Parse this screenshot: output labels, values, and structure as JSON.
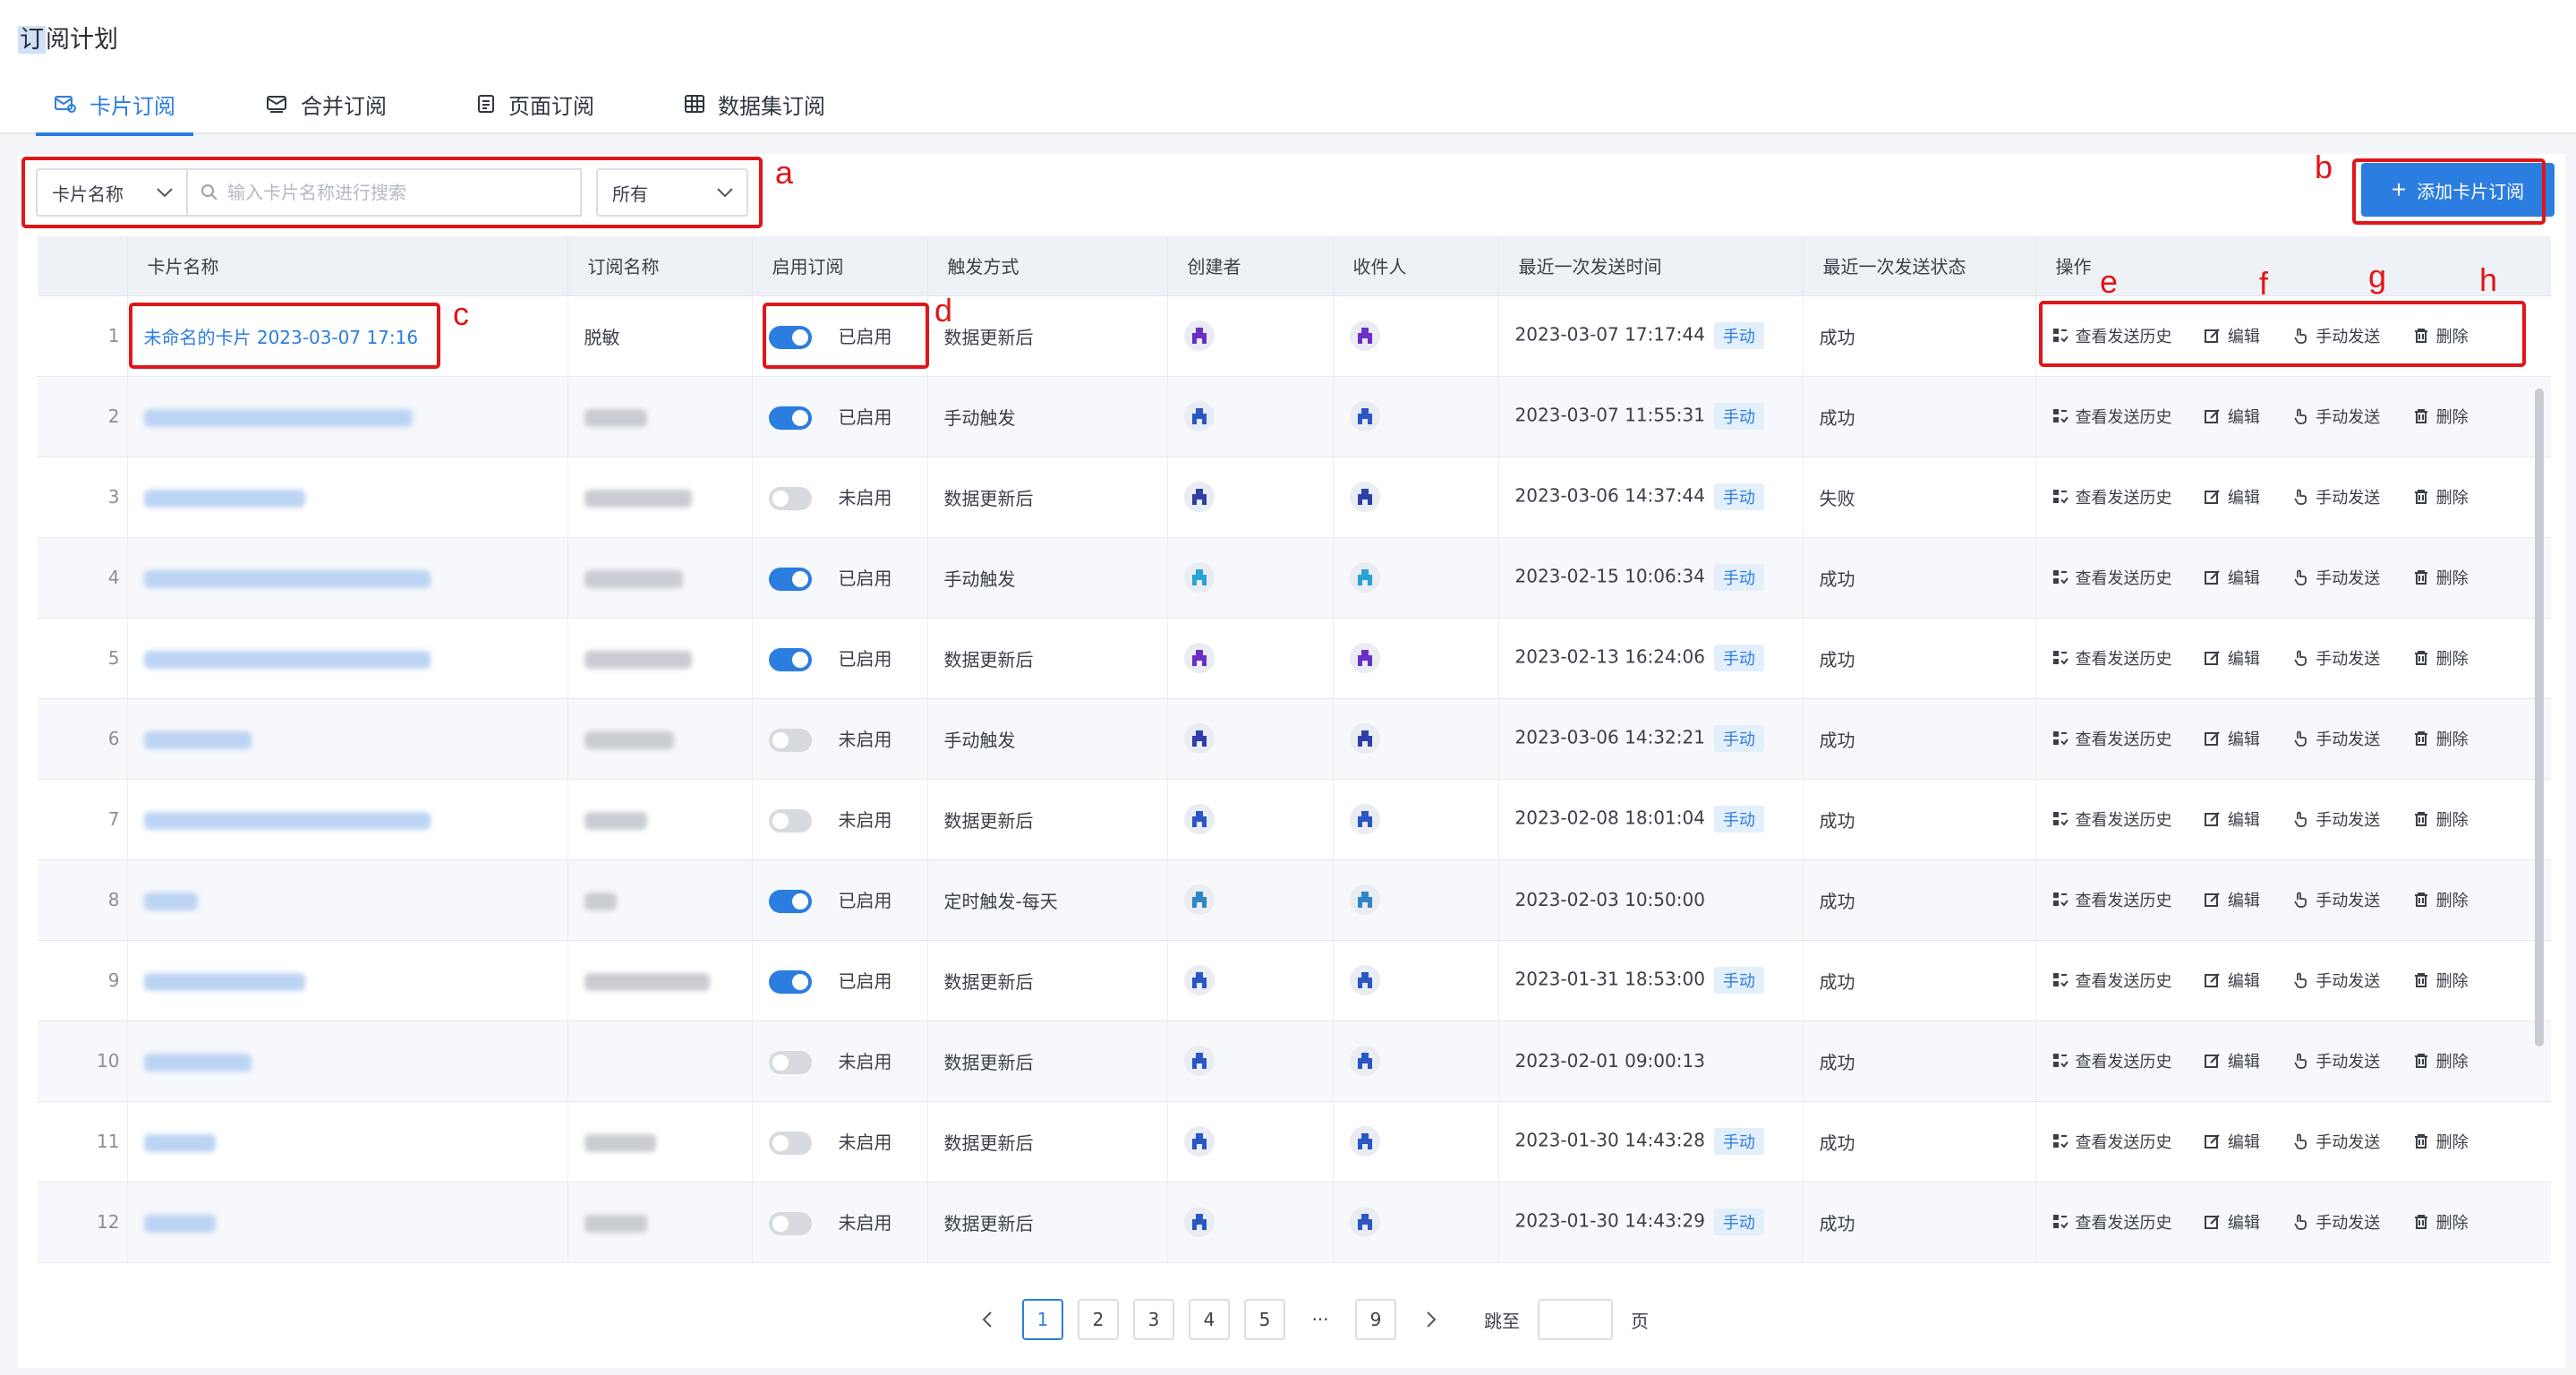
{
  "page_title_highlight": "订",
  "page_title_rest": "阅计划",
  "tabs": [
    {
      "label": "卡片订阅",
      "icon": "card-subscribe-icon",
      "active": true
    },
    {
      "label": "合并订阅",
      "icon": "merge-subscribe-icon",
      "active": false
    },
    {
      "label": "页面订阅",
      "icon": "page-subscribe-icon",
      "active": false
    },
    {
      "label": "数据集订阅",
      "icon": "dataset-subscribe-icon",
      "active": false
    }
  ],
  "filters": {
    "field_select": "卡片名称",
    "search_placeholder": "输入卡片名称进行搜索",
    "status_select": "所有"
  },
  "add_button": "添加卡片订阅",
  "columns": [
    "卡片名称",
    "订阅名称",
    "启用订阅",
    "触发方式",
    "创建者",
    "收件人",
    "最近一次发送时间",
    "最近一次发送状态",
    "操作"
  ],
  "actions": [
    "查看发送历史",
    "编辑",
    "手动发送",
    "删除"
  ],
  "manual_tag": "手动",
  "rows": [
    {
      "index": "1",
      "card_name": "未命名的卡片 2023-03-07 17:16",
      "subscription": "脱敏",
      "enabled": true,
      "status_label": "已启用",
      "trigger": "数据更新后",
      "last_time": "2023-03-07 17:17:44",
      "manual": true,
      "last_status": "成功",
      "avatar_color": "#6a2fc9"
    },
    {
      "index": "2",
      "card_name": "",
      "subscription": "",
      "enabled": true,
      "status_label": "已启用",
      "trigger": "手动触发",
      "last_time": "2023-03-07 11:55:31",
      "manual": true,
      "last_status": "成功",
      "avatar_color": "#2a56c6"
    },
    {
      "index": "3",
      "card_name": "",
      "subscription": "",
      "enabled": false,
      "status_label": "未启用",
      "trigger": "数据更新后",
      "last_time": "2023-03-06 14:37:44",
      "manual": true,
      "last_status": "失败",
      "avatar_color": "#2f3fa8"
    },
    {
      "index": "4",
      "card_name": "",
      "subscription": "",
      "enabled": true,
      "status_label": "已启用",
      "trigger": "手动触发",
      "last_time": "2023-02-15 10:06:34",
      "manual": true,
      "last_status": "成功",
      "avatar_color": "#29a3d6"
    },
    {
      "index": "5",
      "card_name": "",
      "subscription": "",
      "enabled": true,
      "status_label": "已启用",
      "trigger": "数据更新后",
      "last_time": "2023-02-13 16:24:06",
      "manual": true,
      "last_status": "成功",
      "avatar_color": "#6a2fc9"
    },
    {
      "index": "6",
      "card_name": "",
      "subscription": "",
      "enabled": false,
      "status_label": "未启用",
      "trigger": "手动触发",
      "last_time": "2023-03-06 14:32:21",
      "manual": true,
      "last_status": "成功",
      "avatar_color": "#2f3fa8"
    },
    {
      "index": "7",
      "card_name": "",
      "subscription": "",
      "enabled": false,
      "status_label": "未启用",
      "trigger": "数据更新后",
      "last_time": "2023-02-08 18:01:04",
      "manual": true,
      "last_status": "成功",
      "avatar_color": "#2a56c6"
    },
    {
      "index": "8",
      "card_name": "",
      "subscription": "",
      "enabled": true,
      "status_label": "已启用",
      "trigger": "定时触发-每天",
      "last_time": "2023-02-03 10:50:00",
      "manual": false,
      "last_status": "成功",
      "avatar_color": "#2f86c6"
    },
    {
      "index": "9",
      "card_name": "",
      "subscription": "",
      "enabled": true,
      "status_label": "已启用",
      "trigger": "数据更新后",
      "last_time": "2023-01-31 18:53:00",
      "manual": true,
      "last_status": "成功",
      "avatar_color": "#2a56c6"
    },
    {
      "index": "10",
      "card_name": "",
      "subscription": "",
      "enabled": false,
      "status_label": "未启用",
      "trigger": "数据更新后",
      "last_time": "2023-02-01 09:00:13",
      "manual": false,
      "last_status": "成功",
      "avatar_color": "#2a56c6"
    },
    {
      "index": "11",
      "card_name": "",
      "subscription": "",
      "enabled": false,
      "status_label": "未启用",
      "trigger": "数据更新后",
      "last_time": "2023-01-30 14:43:28",
      "manual": true,
      "last_status": "成功",
      "avatar_color": "#2a56c6"
    },
    {
      "index": "12",
      "card_name": "",
      "subscription": "",
      "enabled": false,
      "status_label": "未启用",
      "trigger": "数据更新后",
      "last_time": "2023-01-30 14:43:29",
      "manual": true,
      "last_status": "成功",
      "avatar_color": "#2a56c6"
    }
  ],
  "pagination": {
    "pages": [
      "1",
      "2",
      "3",
      "4",
      "5",
      "···",
      "9"
    ],
    "current": "1",
    "jump_label": "跳至",
    "page_suffix": "页"
  },
  "annotations": [
    "a",
    "b",
    "c",
    "d",
    "e",
    "f",
    "g",
    "h"
  ],
  "colors": {
    "accent": "#2b7de0",
    "annotation": "#e0161a"
  }
}
